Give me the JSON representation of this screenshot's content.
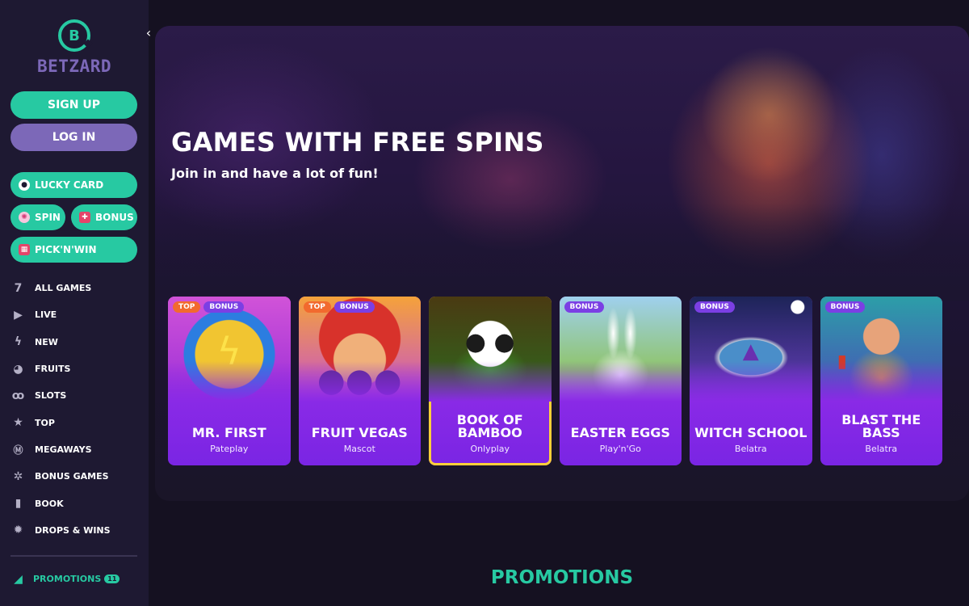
{
  "brand": {
    "name": "BETZARD",
    "letter": "B"
  },
  "colors": {
    "accent": "#27c9a2",
    "secondary": "#7c68b8",
    "badge_top": "#f26a2e",
    "badge_bonus": "#7b3fe4"
  },
  "auth": {
    "signup_label": "SIGN UP",
    "login_label": "LOG IN"
  },
  "quick": {
    "lucky_card": "LUCKY CARD",
    "spin": "SPIN",
    "bonus": "BONUS",
    "pick": "PICK'N'WIN"
  },
  "nav": [
    {
      "label": "ALL GAMES",
      "icon": "seven-icon"
    },
    {
      "label": "LIVE",
      "icon": "play-icon"
    },
    {
      "label": "NEW",
      "icon": "lightning-icon"
    },
    {
      "label": "FRUITS",
      "icon": "fruit-icon"
    },
    {
      "label": "SLOTS",
      "icon": "cherries-icon"
    },
    {
      "label": "TOP",
      "icon": "star-icon"
    },
    {
      "label": "MEGAWAYS",
      "icon": "megaways-icon"
    },
    {
      "label": "BONUS GAMES",
      "icon": "gift-icon"
    },
    {
      "label": "BOOK",
      "icon": "book-icon"
    },
    {
      "label": "DROPS & WINS",
      "icon": "drops-icon"
    }
  ],
  "promotions_nav": {
    "label": "PROMOTIONS",
    "count": "11"
  },
  "hero": {
    "title": "GAMES WITH FREE SPINS",
    "subtitle": "Join in and have a lot of fun!"
  },
  "games": [
    {
      "title": "MR. FIRST",
      "provider": "Pateplay",
      "top": "TOP",
      "bonus": "BONUS"
    },
    {
      "title": "FRUIT VEGAS",
      "provider": "Mascot",
      "top": "TOP",
      "bonus": "BONUS"
    },
    {
      "title": "BOOK OF BAMBOO",
      "provider": "Onlyplay"
    },
    {
      "title": "EASTER EGGS",
      "provider": "Play'n'Go",
      "bonus": "BONUS"
    },
    {
      "title": "WITCH SCHOOL",
      "provider": "Belatra",
      "bonus": "BONUS"
    },
    {
      "title": "BLAST THE BASS",
      "provider": "Belatra",
      "bonus": "BONUS"
    }
  ],
  "promotions_section": {
    "title": "PROMOTIONS"
  }
}
